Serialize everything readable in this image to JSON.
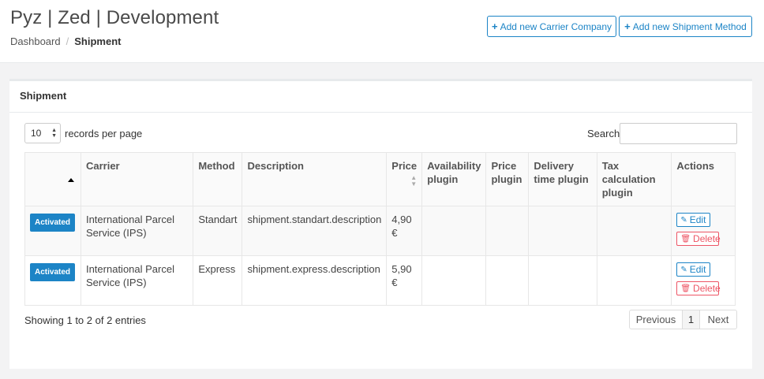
{
  "header": {
    "title": "Pyz | Zed | Development",
    "breadcrumb": {
      "home": "Dashboard",
      "separator": "/",
      "current": "Shipment"
    },
    "buttons": {
      "add_carrier": "Add new Carrier Company",
      "add_method": "Add new Shipment Method"
    }
  },
  "panel": {
    "title": "Shipment",
    "length": {
      "value": "10",
      "label": "records per page"
    },
    "search": {
      "label": "Search:",
      "value": ""
    },
    "columns": [
      "Carrier",
      "Method",
      "Description",
      "Price",
      "Availability plugin",
      "Price plugin",
      "Delivery time plugin",
      "Tax calculation plugin",
      "Actions"
    ],
    "rows": [
      {
        "status": "Activated",
        "carrier": "International Parcel Service (IPS)",
        "method": "Standart",
        "description": "shipment.standart.description",
        "price": "4,90 €",
        "availability_plugin": "",
        "price_plugin": "",
        "delivery_time_plugin": "",
        "tax_plugin": "",
        "edit": "Edit",
        "delete": "Delete"
      },
      {
        "status": "Activated",
        "carrier": "International Parcel Service (IPS)",
        "method": "Express",
        "description": "shipment.express.description",
        "price": "5,90 €",
        "availability_plugin": "",
        "price_plugin": "",
        "delivery_time_plugin": "",
        "tax_plugin": "",
        "edit": "Edit",
        "delete": "Delete"
      }
    ],
    "info": "Showing 1 to 2 of 2 entries",
    "pagination": {
      "previous": "Previous",
      "page": "1",
      "next": "Next"
    }
  },
  "colors": {
    "primary": "#1c84c6",
    "danger": "#ed5565",
    "background": "#f3f3f4"
  },
  "icons": {
    "plus": "plus-icon",
    "edit": "edit-icon",
    "delete": "trash-icon",
    "sort_asc": "sort-asc-icon",
    "sort": "sort-icon"
  }
}
